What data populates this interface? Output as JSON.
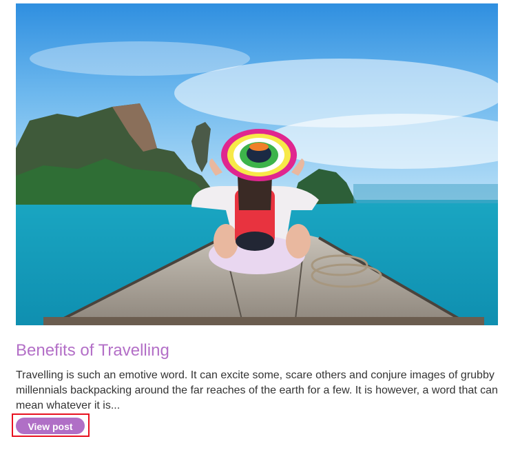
{
  "post": {
    "image_alt": "Woman in colorful hat sitting on the bow of a boat",
    "title": "Benefits of Travelling",
    "excerpt": "Travelling is such an emotive word. It can excite some, scare others and conjure images of grubby millennials backpacking around the far reaches of the earth for a few. It is however, a word that can mean whatever it is...",
    "button_label": "View post"
  },
  "colors": {
    "accent": "#b06fc6",
    "title": "#b36fc7",
    "highlight_border": "#e8101f"
  }
}
